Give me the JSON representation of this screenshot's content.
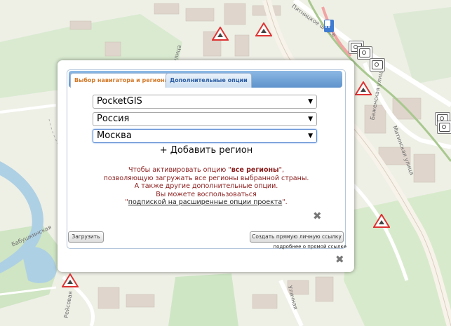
{
  "map": {
    "street_labels": [
      "Митинская улица",
      "улица",
      "Пятницкое шоссе",
      "Баженская улица",
      "Рейсовая",
      "Уличная",
      "Бабушкинская"
    ],
    "markers": {
      "camera": "camera-icon",
      "warning": "warning-triangle-icon",
      "bus": "bus-stop-icon"
    }
  },
  "dialog": {
    "tabs": [
      {
        "label": "Выбор навигатора и региона",
        "active": true
      },
      {
        "label": "Дополнительные опции",
        "active": false
      }
    ],
    "selects": {
      "navigator": "PocketGIS",
      "country": "Россия",
      "region": "Москва"
    },
    "add_region": "+ Добавить регион",
    "info": {
      "line1_pre": "Чтобы активировать опцию \"",
      "line1_bold": "все регионы",
      "line1_post": "\",",
      "line2": "позволяющую загружать все регионы выбранной страны.",
      "line3": "А также другие дополнительные опции.",
      "line4": "Вы можете воспользоваться",
      "line5_pre": "\"",
      "line5_link": "подпиской на расширенные опции проекта",
      "line5_post": "\"."
    },
    "buttons": {
      "load": "Загрузить",
      "create_link": "Создать прямую личную ссылку"
    },
    "about_link": "подробнее о прямой ссылке"
  },
  "colors": {
    "tab_active_text": "#d37a2a",
    "tab_inactive_text": "#2d5ea3",
    "info_text": "#8a1c1c",
    "tabbar": "#5f93cc"
  }
}
